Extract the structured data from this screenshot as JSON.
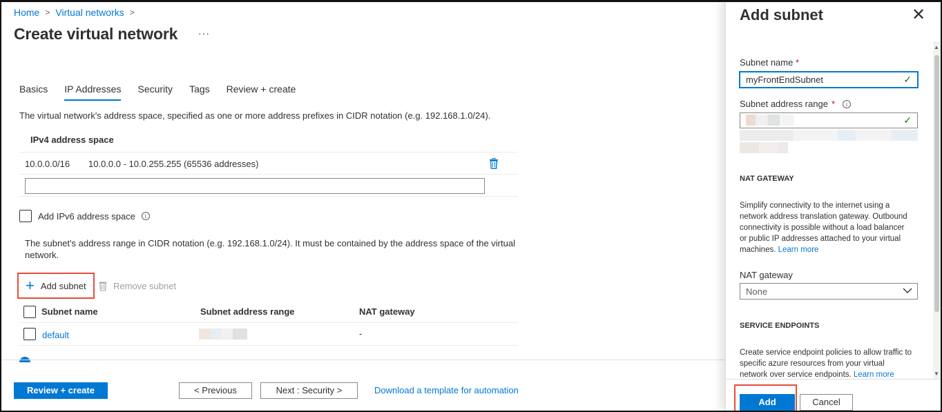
{
  "breadcrumb": [
    "Home",
    "Virtual networks"
  ],
  "page": {
    "title": "Create virtual network",
    "more": "···"
  },
  "tabs": [
    {
      "label": "Basics",
      "active": false
    },
    {
      "label": "IP Addresses",
      "active": true
    },
    {
      "label": "Security",
      "active": false
    },
    {
      "label": "Tags",
      "active": false
    },
    {
      "label": "Review + create",
      "active": false
    }
  ],
  "ip": {
    "description": "The virtual network's address space, specified as one or more address prefixes in CIDR notation (e.g. 192.168.1.0/24).",
    "header": "IPv4 address space",
    "rows": [
      {
        "prefix": "10.0.0.0/16",
        "range": "10.0.0.0 - 10.0.255.255 (65536 addresses)"
      }
    ],
    "new_value": "",
    "ipv6_label": "Add IPv6 address space",
    "subnet_description": "The subnet's address range in CIDR notation (e.g. 192.168.1.0/24). It must be contained by the address space of the virtual network."
  },
  "subnets": {
    "add_label": "Add subnet",
    "remove_label": "Remove subnet",
    "columns": [
      "Subnet name",
      "Subnet address range",
      "NAT gateway"
    ],
    "rows": [
      {
        "name": "default",
        "range": "",
        "nat": "-"
      }
    ]
  },
  "footer": {
    "review": "Review + create",
    "previous": "< Previous",
    "next": "Next : Security >",
    "download": "Download a template for automation"
  },
  "panel": {
    "title": "Add subnet",
    "close": "✕",
    "subnet_name_label": "Subnet name",
    "subnet_name_value": "myFrontEndSubnet",
    "range_label": "Subnet address range",
    "required_mark": "*",
    "nat_heading": "NAT GATEWAY",
    "nat_description": "Simplify connectivity to the internet using a network address translation gateway. Outbound connectivity is possible without a load balancer or public IP addresses attached to your virtual machines.",
    "learn_more": "Learn more",
    "nat_label": "NAT gateway",
    "nat_value": "None",
    "se_heading": "SERVICE ENDPOINTS",
    "se_description": "Create service endpoint policies to allow traffic to specific azure resources from your virtual network over service endpoints.",
    "add": "Add",
    "cancel": "Cancel"
  },
  "colors": {
    "accent": "#0078d4",
    "highlight": "#e74c3c",
    "success": "#107c10"
  },
  "icons": [
    "chevron-right-icon",
    "more-icon",
    "trash-icon",
    "info-icon",
    "plus-icon",
    "checkmark-icon",
    "chevron-down-icon",
    "close-icon"
  ]
}
